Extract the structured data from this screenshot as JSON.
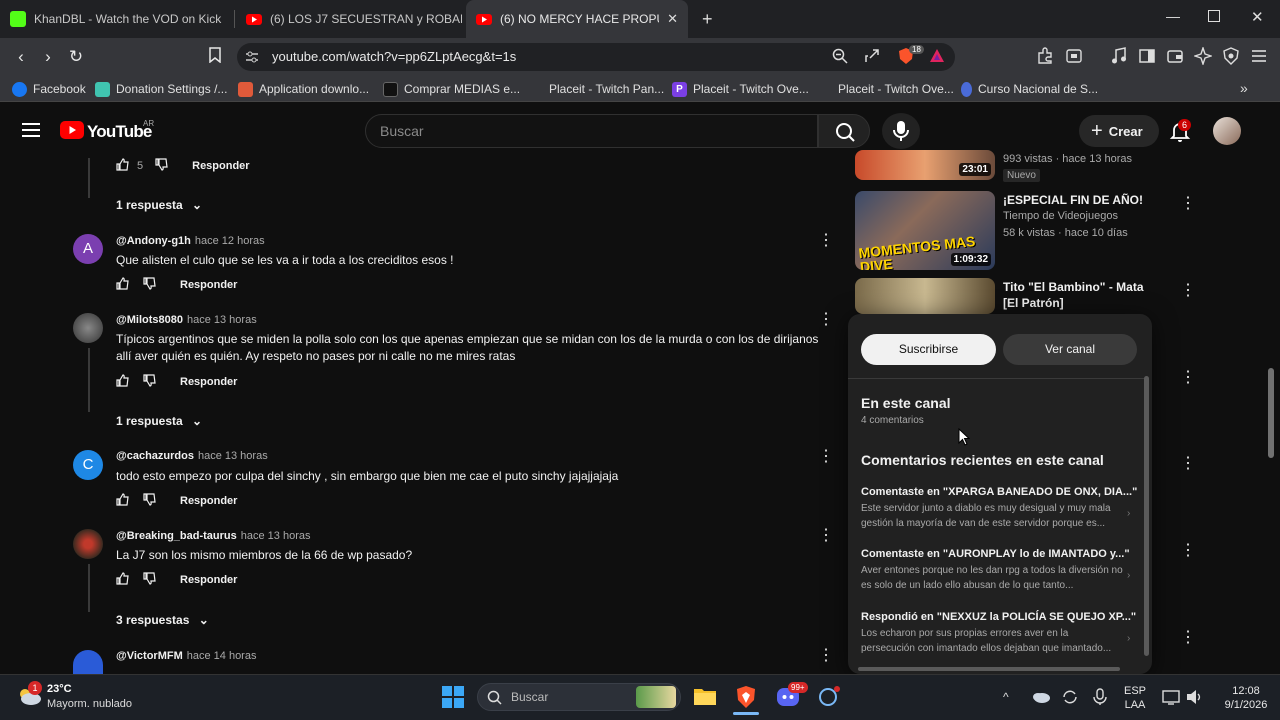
{
  "browser": {
    "tabs": [
      {
        "title": "KhanDBL - Watch the VOD on Kick",
        "active": false
      },
      {
        "title": "(6) LOS J7 SECUESTRAN y ROBAN a L",
        "active": false
      },
      {
        "title": "(6) NO MERCY HACE PROPUESTA",
        "active": true
      }
    ],
    "url": "youtube.com/watch?v=pp6ZLptAecg&t=1s",
    "extension_badge": "18",
    "bookmarks": [
      "Facebook",
      "Donation Settings /...",
      "Application downlo...",
      "Comprar MEDIAS e...",
      "Placeit - Twitch Pan...",
      "Placeit - Twitch Ove...",
      "Placeit - Twitch Ove...",
      "Curso Nacional de S..."
    ]
  },
  "youtube": {
    "logo": "YouTube",
    "country": "AR",
    "search_placeholder": "Buscar",
    "create_label": "Crear",
    "notification_count": "6"
  },
  "comments": {
    "top": {
      "likes": "5",
      "reply_label": "Responder",
      "replies": "1 respuesta"
    },
    "items": [
      {
        "initial": "A",
        "avatar_color": "#7b3fb0",
        "author": "@Andony-g1h",
        "time": "hace 12 horas",
        "text": "Que alisten el culo que se les va a ir toda a los creciditos esos !",
        "reply_label": "Responder",
        "replies": ""
      },
      {
        "initial": "",
        "avatar_color": "#4a4a4a",
        "author": "@Milots8080",
        "time": "hace 13 horas",
        "text": "Típicos argentinos que se miden la polla solo con los que apenas empiezan  que se midan con los de la murda o con los de dirijanos allí aver quién es quién.  Ay respeto no pases por ni calle no me mires  ratas",
        "reply_label": "Responder",
        "replies": "1 respuesta"
      },
      {
        "initial": "C",
        "avatar_color": "#1e88e5",
        "author": "@cachazurdos",
        "time": "hace 13 horas",
        "text": "todo esto empezo por culpa del sinchy , sin embargo que bien me cae el puto sinchy jajajjajaja",
        "reply_label": "Responder",
        "replies": ""
      },
      {
        "initial": "",
        "avatar_color": "#5a4030",
        "author": "@Breaking_bad-taurus",
        "time": "hace 13 horas",
        "text": "La J7 son los mismo miembros de la 66 de wp pasado?",
        "reply_label": "Responder",
        "replies": "3 respuestas"
      },
      {
        "initial": "",
        "avatar_color": "#2a5bd7",
        "author": "@VictorMFM",
        "time": "hace 14 horas",
        "text": "",
        "reply_label": "",
        "replies": ""
      }
    ]
  },
  "sidebar": {
    "videos": [
      {
        "title": "",
        "channel": "",
        "meta": "993 vistas · hace 13 horas",
        "badge": "Nuevo",
        "duration": "23:01"
      },
      {
        "title": "¡ESPECIAL FIN DE AÑO!",
        "channel": "Tiempo de Videojuegos",
        "meta": "58 k vistas · hace 10 días",
        "badge": "",
        "duration": "1:09:32",
        "thumb_text": "MOMENTOS MAS DIVE"
      },
      {
        "title": "Tito \"El Bambino\" - Mata [El Patrón]",
        "channel": "",
        "meta": "",
        "badge": "",
        "duration": ""
      }
    ]
  },
  "popup": {
    "subscribe": "Suscribirse",
    "view_channel": "Ver canal",
    "section_title": "En este canal",
    "comment_count": "4 comentarios",
    "recent_title": "Comentarios recientes en este canal",
    "recent": [
      {
        "title": "Comentaste en \"XPARGA BANEADO DE ONX, DIA...\"",
        "snippet": "Este servidor junto a diablo es muy desigual y muy mala gestión la mayoría de van de este servidor porque es..."
      },
      {
        "title": "Comentaste en \"AURONPLAY lo de IMANTADO y...\"",
        "snippet": "Aver entones porque no les dan rpg a todos la diversión no es solo de un lado ello abusan de lo que tanto..."
      },
      {
        "title": "Respondió en \"NEXXUZ la POLICÍA SE QUEJO XP...\"",
        "snippet": "Los echaron por sus propias errores aver en la persecución con imantado ellos dejaban que imantado..."
      }
    ]
  },
  "taskbar": {
    "weather_temp": "23°C",
    "weather_desc": "Mayorm. nublado",
    "weather_badge": "1",
    "search_label": "Buscar",
    "discord_badge": "99+",
    "lang_top": "ESP",
    "lang_bottom": "LAA",
    "time": "12:08",
    "date": "9/1/2026"
  }
}
